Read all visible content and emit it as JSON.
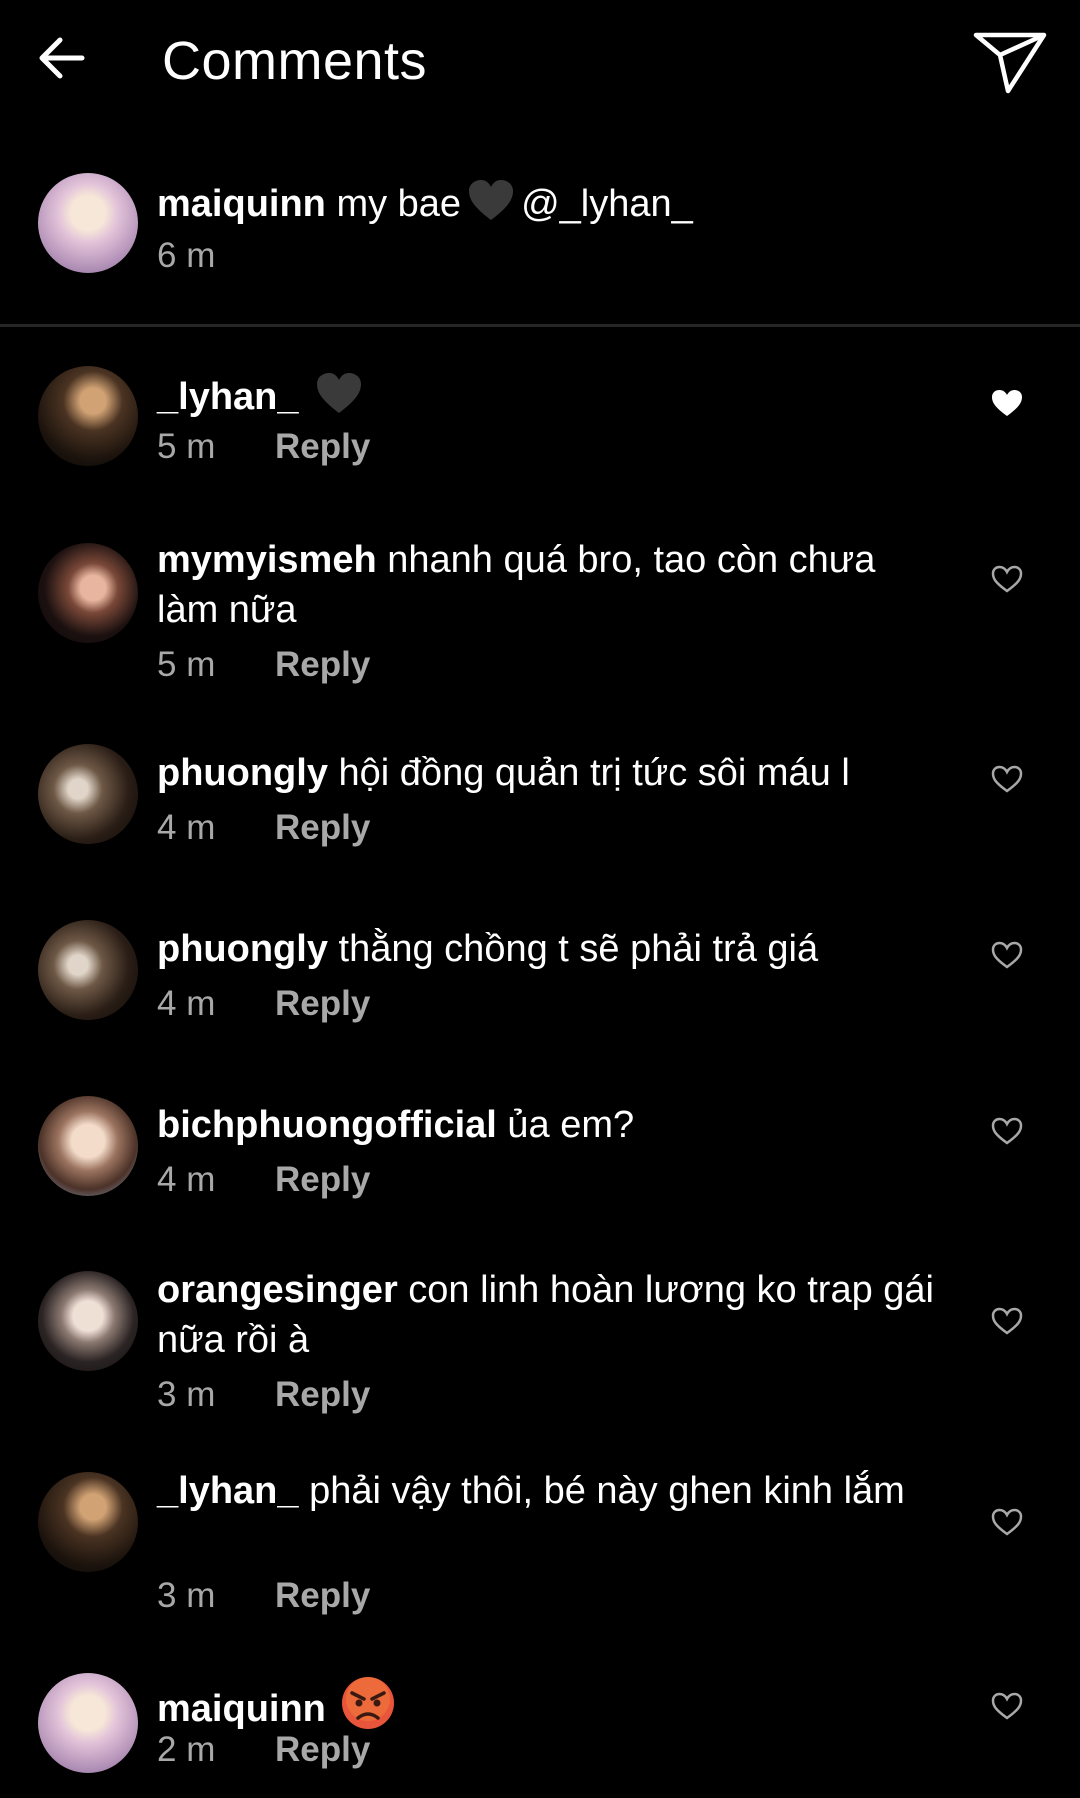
{
  "header": {
    "title": "Comments"
  },
  "caption": {
    "username": "maiquinn",
    "text_before": "my bae",
    "text_after": "@_lyhan_",
    "time": "6 m"
  },
  "reply_label": "Reply",
  "comments": [
    {
      "username": "_lyhan_",
      "text": "",
      "time": "5 m",
      "liked": true
    },
    {
      "username": "mymyismeh",
      "text": "nhanh quá bro, tao còn chưa làm nữa",
      "time": "5 m",
      "liked": false
    },
    {
      "username": "phuongly",
      "text": "hội đồng quản trị tức sôi máu l",
      "time": "4 m",
      "liked": false
    },
    {
      "username": "phuongly",
      "text": "thằng chồng t sẽ phải trả giá",
      "time": "4 m",
      "liked": false
    },
    {
      "username": "bichphuongofficial",
      "text": "ủa em?",
      "time": "4 m",
      "liked": false
    },
    {
      "username": "orangesinger",
      "text": "con linh hoàn lương ko trap gái nữa rồi à",
      "time": "3 m",
      "liked": false
    },
    {
      "username": "_lyhan_",
      "text": "phải vậy thôi, bé này ghen kinh lắm",
      "time": "3 m",
      "liked": false
    },
    {
      "username": "maiquinn",
      "text": "",
      "time": "2 m",
      "liked": false
    }
  ],
  "icons": {
    "back": "arrow-left-icon",
    "send": "paper-plane-icon",
    "like": "heart-icon",
    "black_heart": "black-heart-emoji",
    "angry": "angry-face-emoji"
  },
  "colors": {
    "background": "#000000",
    "text": "#ffffff",
    "secondary": "#a8a8a8",
    "divider": "#262626"
  }
}
